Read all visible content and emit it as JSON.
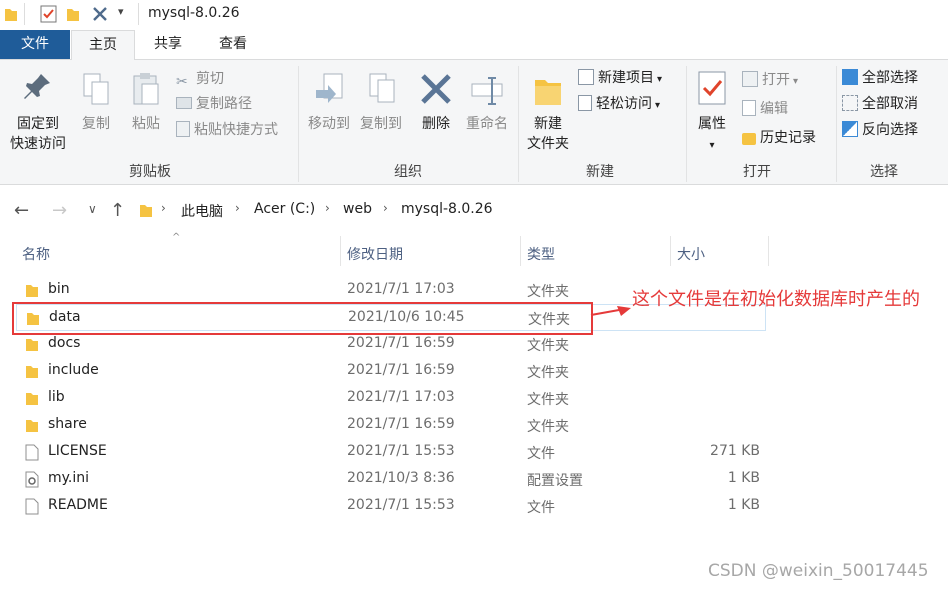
{
  "window": {
    "title": "mysql-8.0.26"
  },
  "tabs": [
    {
      "label": "文件"
    },
    {
      "label": "主页"
    },
    {
      "label": "共享"
    },
    {
      "label": "查看"
    }
  ],
  "ribbon": {
    "clipboard": {
      "group_label": "剪贴板",
      "pin_line1": "固定到",
      "pin_line2": "快速访问",
      "copy": "复制",
      "paste": "粘贴",
      "cut": "剪切",
      "copy_path": "复制路径",
      "paste_shortcut": "粘贴快捷方式"
    },
    "organize": {
      "group_label": "组织",
      "move_to": "移动到",
      "copy_to": "复制到",
      "delete": "删除",
      "rename": "重命名"
    },
    "new": {
      "group_label": "新建",
      "new_folder_line1": "新建",
      "new_folder_line2": "文件夹",
      "new_item": "新建项目",
      "easy_access": "轻松访问"
    },
    "open": {
      "group_label": "打开",
      "properties": "属性",
      "open": "打开",
      "edit": "编辑",
      "history": "历史记录"
    },
    "select": {
      "group_label": "选择",
      "select_all": "全部选择",
      "select_none": "全部取消",
      "invert": "反向选择"
    }
  },
  "address": {
    "crumbs": [
      "此电脑",
      "Acer (C:)",
      "web",
      "mysql-8.0.26"
    ]
  },
  "columns": {
    "name": "名称",
    "date": "修改日期",
    "type": "类型",
    "size": "大小"
  },
  "files": [
    {
      "name": "bin",
      "date": "2021/7/1 17:03",
      "type": "文件夹",
      "size": "",
      "kind": "folder"
    },
    {
      "name": "data",
      "date": "2021/10/6 10:45",
      "type": "文件夹",
      "size": "",
      "kind": "folder"
    },
    {
      "name": "docs",
      "date": "2021/7/1 16:59",
      "type": "文件夹",
      "size": "",
      "kind": "folder"
    },
    {
      "name": "include",
      "date": "2021/7/1 16:59",
      "type": "文件夹",
      "size": "",
      "kind": "folder"
    },
    {
      "name": "lib",
      "date": "2021/7/1 17:03",
      "type": "文件夹",
      "size": "",
      "kind": "folder"
    },
    {
      "name": "share",
      "date": "2021/7/1 16:59",
      "type": "文件夹",
      "size": "",
      "kind": "folder"
    },
    {
      "name": "LICENSE",
      "date": "2021/7/1 15:53",
      "type": "文件",
      "size": "271 KB",
      "kind": "file"
    },
    {
      "name": "my.ini",
      "date": "2021/10/3 8:36",
      "type": "配置设置",
      "size": "1 KB",
      "kind": "ini"
    },
    {
      "name": "README",
      "date": "2021/7/1 15:53",
      "type": "文件",
      "size": "1 KB",
      "kind": "file"
    }
  ],
  "annotation": {
    "text": "这个文件是在初始化数据库时产生的",
    "color": "#e53a3a"
  },
  "watermark": "CSDN @weixin_50017445",
  "colors": {
    "file_tab": "#1f5c99",
    "folder": "#f5c342",
    "ribbon_bg": "#f5f6f7"
  }
}
